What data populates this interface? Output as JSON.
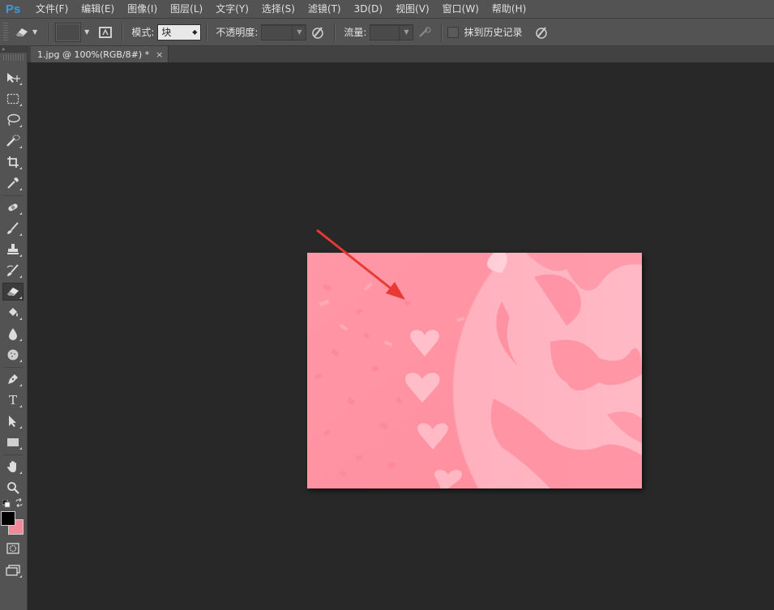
{
  "app": {
    "logo": "Ps"
  },
  "menu": [
    "文件(F)",
    "编辑(E)",
    "图像(I)",
    "图层(L)",
    "文字(Y)",
    "选择(S)",
    "滤镜(T)",
    "3D(D)",
    "视图(V)",
    "窗口(W)",
    "帮助(H)"
  ],
  "options": {
    "mode_label": "模式:",
    "mode_value": "块",
    "opacity_label": "不透明度:",
    "opacity_value": "",
    "flow_label": "流量:",
    "flow_value": "",
    "erase_history_label": "抹到历史记录"
  },
  "document": {
    "tab_title": "1.jpg @ 100%(RGB/8#) *",
    "close": "×"
  },
  "colors": {
    "foreground": "#000000",
    "background": "#f08a98",
    "image_pink": "#ff98a6",
    "arrow": "#e83a32"
  },
  "tools": [
    "move-tool",
    "marquee-tool",
    "lasso-tool",
    "quick-selection-tool",
    "crop-tool",
    "eyedropper-tool",
    "spot-healing-tool",
    "brush-tool",
    "clone-stamp-tool",
    "history-brush-tool",
    "eraser-tool",
    "paint-bucket-tool",
    "blur-tool",
    "dodge-tool",
    "pen-tool",
    "type-tool",
    "path-selection-tool",
    "rectangle-tool",
    "hand-tool",
    "zoom-tool"
  ],
  "type_tool_glyph": "T"
}
